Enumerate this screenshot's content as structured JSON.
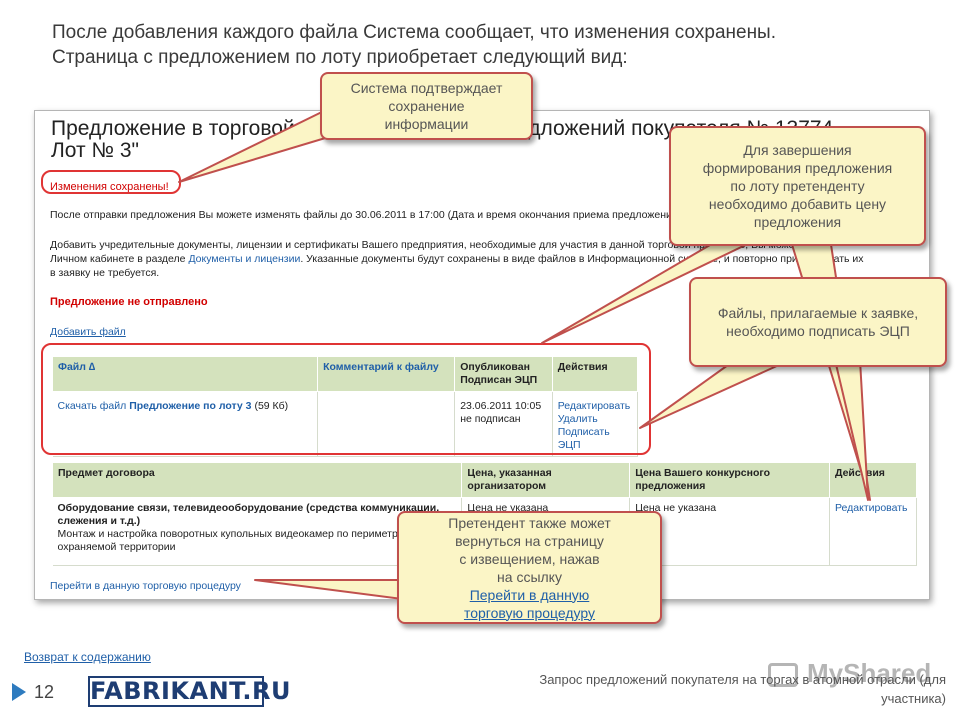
{
  "intro": {
    "line1": "После добавления каждого файла Система сообщает, что изменения сохранены.",
    "line2": "Страница с предложением по лоту приобретает следующий вид:"
  },
  "screenshot": {
    "title_line1": "Предложение в торговой процедуре запроса предложений покупателя № 13774",
    "title_line2": "Лот № 3\"",
    "saved_message": "Изменения сохранены!",
    "para1": "После отправки предложения Вы можете изменять файлы до 30.06.2011 в 17:00 (Дата и время окончания приема предложений).",
    "para2_line1": "Добавить учредительные документы, лицензии и сертификаты Вашего предприятия, необходимые для участия в данной торговой процедуре, Вы можете в",
    "para2_line2_pre": "Личном кабинете в разделе ",
    "para2_link": "Документы и лицензии",
    "para2_line2_post": ". Указанные документы будут сохранены в виде файлов в Информационной системе, и повторно прикладывать их",
    "para2_line3": "в заявку не требуется.",
    "not_sent": "Предложение не отправлено",
    "add_file": "Добавить файл",
    "files_table": {
      "headers": [
        "Файл ∆",
        "Комментарий к файлу",
        "Опубликован Подписан ЭЦП",
        "Действия"
      ],
      "row": {
        "download_prefix": "Скачать файл ",
        "file_name": "Предложение по лоту 3",
        "file_size": " (59 Кб)",
        "comment": "",
        "published": "23.06.2011 10:05",
        "signed": "не подписан",
        "actions": [
          "Редактировать",
          "Удалить",
          "Подписать ЭЦП"
        ]
      }
    },
    "lots_table": {
      "headers": [
        "Предмет договора",
        "Цена, указанная организатором",
        "Цена Вашего конкурсного предложения",
        "Действия"
      ],
      "row": {
        "subject_bold": "Оборудование связи, телевидеооборудование (средства коммуникации, слежения и т.д.)",
        "subject_desc": "Монтаж и настройка поворотных купольных видеокамер по периметру охраняемой территории",
        "org_price": "Цена не указана",
        "offer_price": "Цена не указана",
        "action": "Редактировать"
      }
    },
    "goto_procedure": "Перейти в данную торговую процедуру"
  },
  "callouts": {
    "confirm": [
      "Система подтверждает",
      "сохранение",
      "информации"
    ],
    "price": [
      "Для завершения",
      "формирования предложения",
      "по лоту претенденту",
      "необходимо добавить цену",
      "предложения"
    ],
    "sign": [
      "Файлы, прилагаемые к заявке,",
      "необходимо подписать ЭЦП"
    ],
    "return_lines": [
      "Претендент также может",
      "вернуться на страницу",
      "с извещением, нажав"
    ],
    "return_prefix": "на ссылку ",
    "return_link1": "Перейти в данную",
    "return_link2": "торговую процедуру"
  },
  "footer": {
    "back_link": "Возврат к содержанию",
    "page_number": "12",
    "logo": "FABRIKANT.RU",
    "caption_line1": "Запрос предложений покупателя на торгах в атомной отрасли (для",
    "caption_line2": "участника)",
    "watermark": "MyShared"
  },
  "colors": {
    "accent_red": "#c0504d",
    "callout_fill": "#fbf5c6",
    "table_header": "#d4e2bd",
    "link_blue": "#1f5fa8"
  }
}
